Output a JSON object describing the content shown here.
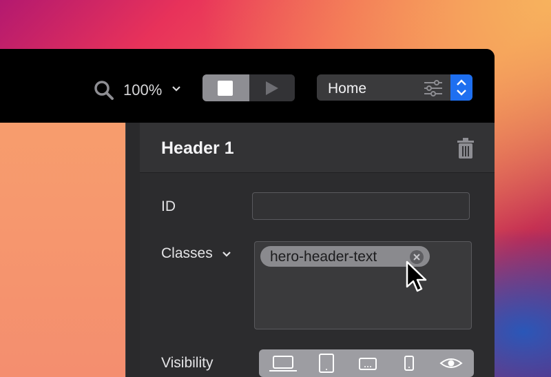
{
  "toolbar": {
    "zoom": "100%",
    "zoom_icon": "magnifier-icon",
    "mode_buttons": [
      "design-mode",
      "preview-mode"
    ],
    "page_selector": {
      "label": "Home",
      "settings_icon": "sliders-icon",
      "stepper_icon": "updown-chevron-icon"
    }
  },
  "panel": {
    "title": "Header 1",
    "delete_icon": "trash-icon",
    "id_label": "ID",
    "id_value": "",
    "classes_label": "Classes",
    "classes": [
      "hero-header-text"
    ],
    "visibility_label": "Visibility",
    "visibility_devices": [
      "laptop-icon",
      "tablet-icon",
      "tablet-landscape-icon",
      "phone-icon",
      "eye-icon"
    ]
  },
  "colors": {
    "accent": "#1e6ff0",
    "panel_bg": "#2c2c2e",
    "toolbar_bg": "#000000"
  }
}
